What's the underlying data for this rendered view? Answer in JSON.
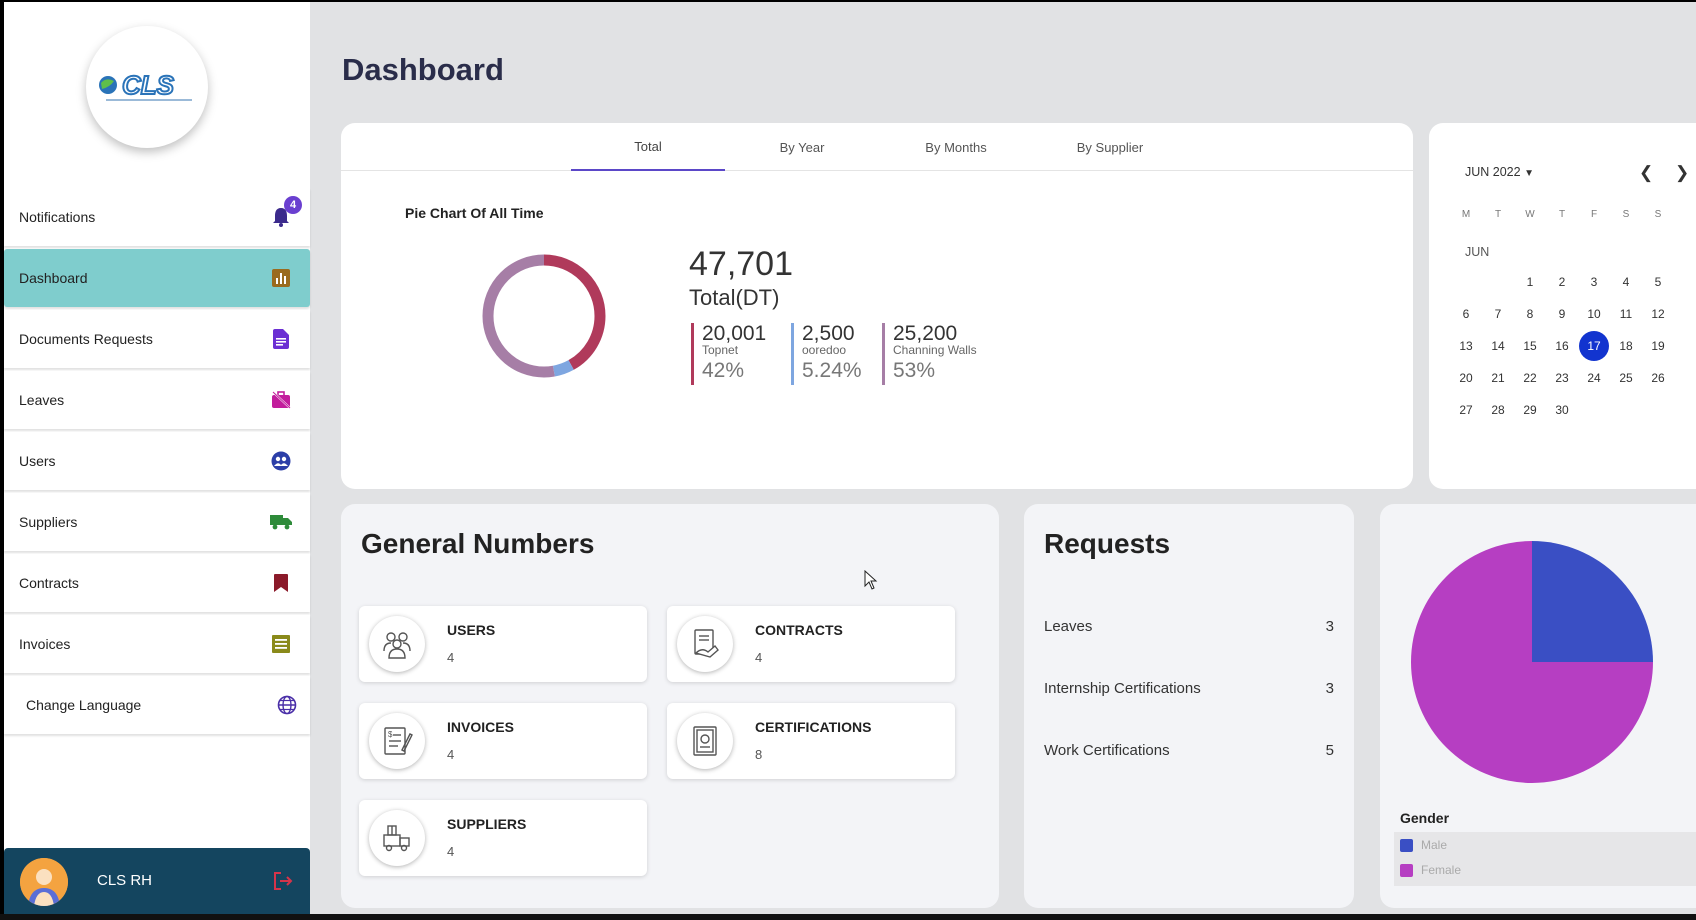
{
  "colors": {
    "accent": "#5b47c8",
    "active_nav": "#7fcdcd",
    "user_bar": "#14455f",
    "today": "#1234cf",
    "topnet": "#b03a5b",
    "ooredoo": "#7ea6e0",
    "channing": "#a67ea6",
    "male": "#3a4fc4",
    "female": "#b63ec2"
  },
  "logo": {
    "text": "CLS"
  },
  "sidebar": {
    "items": [
      {
        "label": "Notifications",
        "icon": "bell-icon",
        "badge": "4"
      },
      {
        "label": "Dashboard",
        "icon": "bar-chart-icon"
      },
      {
        "label": "Documents Requests",
        "icon": "document-icon"
      },
      {
        "label": "Leaves",
        "icon": "suitcase-off-icon"
      },
      {
        "label": "Users",
        "icon": "users-globe-icon"
      },
      {
        "label": "Suppliers",
        "icon": "truck-icon"
      },
      {
        "label": "Contracts",
        "icon": "bookmark-icon"
      },
      {
        "label": "Invoices",
        "icon": "list-icon"
      },
      {
        "label": "Change Language",
        "icon": "globe-icon"
      }
    ],
    "user": {
      "name": "CLS RH"
    }
  },
  "page": {
    "title": "Dashboard"
  },
  "tabs": [
    "Total",
    "By Year",
    "By Months",
    "By Supplier"
  ],
  "pie_card": {
    "title": "Pie Chart Of All Time",
    "total_value": "47,701",
    "total_label": "Total(DT)",
    "stats": [
      {
        "value": "20,001",
        "name": "Topnet",
        "percent": "42%",
        "share": 42
      },
      {
        "value": "2,500",
        "name": "ooredoo",
        "percent": "5.24%",
        "share": 5.24
      },
      {
        "value": "25,200",
        "name": "Channing Walls",
        "percent": "53%",
        "share": 53
      }
    ]
  },
  "calendar": {
    "header": "JUN 2022",
    "month_label": "JUN",
    "weekdays": [
      "M",
      "T",
      "W",
      "T",
      "F",
      "S",
      "S"
    ],
    "first_weekday_index": 2,
    "days": 30,
    "today": 17
  },
  "general": {
    "title": "General Numbers",
    "items": [
      {
        "label": "USERS",
        "value": "4",
        "icon": "users-icon"
      },
      {
        "label": "CONTRACTS",
        "value": "4",
        "icon": "contract-icon"
      },
      {
        "label": "INVOICES",
        "value": "4",
        "icon": "invoice-icon"
      },
      {
        "label": "CERTIFICATIONS",
        "value": "8",
        "icon": "certificate-icon"
      },
      {
        "label": "SUPPLIERS",
        "value": "4",
        "icon": "supplier-icon"
      }
    ]
  },
  "requests": {
    "title": "Requests",
    "items": [
      {
        "label": "Leaves",
        "count": "3"
      },
      {
        "label": "Internship Certifications",
        "count": "3"
      },
      {
        "label": "Work Certifications",
        "count": "5"
      }
    ]
  },
  "gender": {
    "title": "Gender",
    "legend": [
      "Male",
      "Female"
    ]
  },
  "chart_data": {
    "type": "pie",
    "categories": [
      "Male",
      "Female"
    ],
    "values": [
      25,
      75
    ],
    "title": "Gender"
  }
}
